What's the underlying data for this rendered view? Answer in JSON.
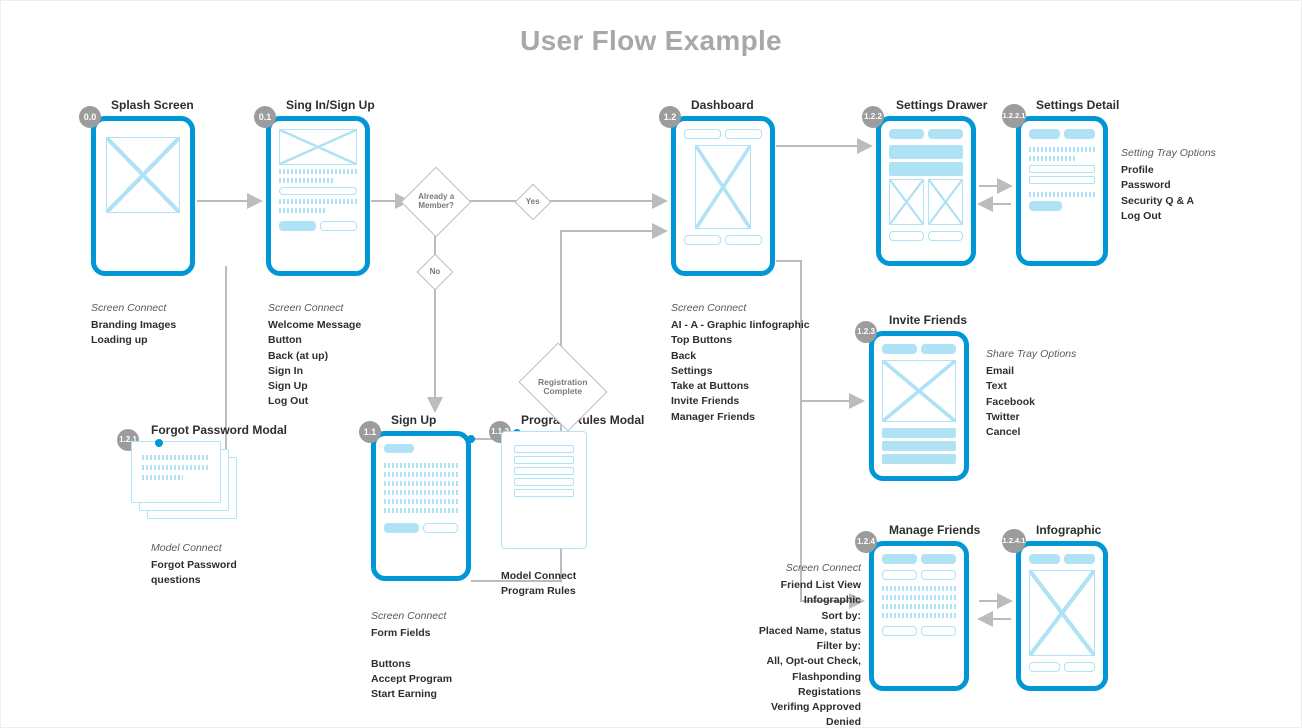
{
  "title": "User Flow Example",
  "screens": {
    "splash": {
      "badge": "0.0",
      "label": "Splash Screen"
    },
    "signin": {
      "badge": "0.1",
      "label": "Sing In/Sign Up"
    },
    "dashboard": {
      "badge": "1.2",
      "label": "Dashboard"
    },
    "settings": {
      "badge": "1.2.2",
      "label": "Settings Drawer"
    },
    "detail": {
      "badge": "1.2.2.1",
      "label": "Settings Detail"
    },
    "signup": {
      "badge": "1.1",
      "label": "Sign Up"
    },
    "rules": {
      "badge": "1.1.2",
      "label": "Program Rules Modal"
    },
    "forgot": {
      "badge": "1.2.1",
      "label": "Forgot Password Modal"
    },
    "invite": {
      "badge": "1.2.3",
      "label": "Invite Friends"
    },
    "manage": {
      "badge": "1.2.4",
      "label": "Manage Friends"
    },
    "info": {
      "badge": "1.2.4.1",
      "label": "Infographic"
    }
  },
  "decisions": {
    "member": "Already a Member?",
    "yes": "Yes",
    "no": "No",
    "regcomplete": "Registration Complete"
  },
  "notes": {
    "splash": {
      "h": "Screen Connect",
      "lines": [
        "Branding Images",
        "Loading up"
      ]
    },
    "signin": {
      "h": "Screen Connect",
      "lines": [
        "Welcome Message",
        "Button",
        "Back (at up)",
        "Sign In",
        "Sign Up",
        "Log Out"
      ]
    },
    "dashboard": {
      "h": "Screen Connect",
      "lines": [
        "AI - A - Graphic Iinfographic",
        "Top Buttons",
        "Back",
        "Settings",
        "Take at Buttons",
        "Invite Friends",
        "Manager Friends"
      ]
    },
    "signup": {
      "h": "Screen Connect",
      "lines": [
        "Form Fields",
        "",
        "Buttons",
        "Accept Program",
        "Start Earning"
      ]
    },
    "forgot": {
      "h": "Model Connect",
      "lines": [
        "Forgot Password",
        "questions"
      ]
    },
    "rules": {
      "h": "Model Connect",
      "lines": [
        "Program Rules"
      ]
    },
    "detail": {
      "h": "Setting Tray Options",
      "lines": [
        "Profile",
        "Password",
        "Security Q & A",
        "Log Out"
      ]
    },
    "invite": {
      "h": "Share Tray Options",
      "lines": [
        "Email",
        "Text",
        "Facebook",
        "Twitter",
        "Cancel"
      ]
    },
    "manage": {
      "h": "Screen Connect",
      "lines": [
        "Friend List View",
        "Infographic",
        "Sort by:",
        "Placed Name, status",
        "Filter by:",
        "All, Opt-out Check,",
        "Flashponding  Registations",
        "Verifing Approved Denied"
      ]
    }
  }
}
